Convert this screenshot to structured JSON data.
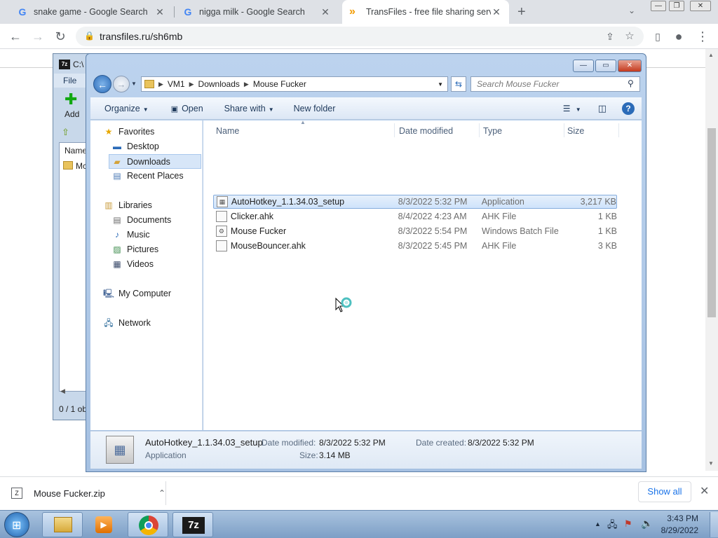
{
  "browser": {
    "tabs": [
      {
        "title": "snake game - Google Search"
      },
      {
        "title": "nigga milk - Google Search"
      },
      {
        "title": "TransFiles - free file sharing servi"
      }
    ],
    "url": "transfiles.ru/sh6mb"
  },
  "sevenzip": {
    "title_fragment": "C:\\",
    "menu_file": "File",
    "add_label": "Add",
    "column_name": "Name",
    "item_fragment": "Mc",
    "status_fragment": "0 / 1 ob"
  },
  "explorer": {
    "breadcrumb": [
      "VM1",
      "Downloads",
      "Mouse Fucker"
    ],
    "search_placeholder": "Search Mouse Fucker",
    "commands": {
      "organize": "Organize",
      "open": "Open",
      "share_with": "Share with",
      "new_folder": "New folder"
    },
    "nav": {
      "favorites": "Favorites",
      "desktop": "Desktop",
      "downloads": "Downloads",
      "recent_places": "Recent Places",
      "libraries": "Libraries",
      "documents": "Documents",
      "music": "Music",
      "pictures": "Pictures",
      "videos": "Videos",
      "my_computer": "My Computer",
      "network": "Network"
    },
    "columns": {
      "name": "Name",
      "date": "Date modified",
      "type": "Type",
      "size": "Size"
    },
    "files": [
      {
        "name": "AutoHotkey_1.1.34.03_setup",
        "date": "8/3/2022 5:32 PM",
        "type": "Application",
        "size": "3,217 KB"
      },
      {
        "name": "Clicker.ahk",
        "date": "8/4/2022 4:23 AM",
        "type": "AHK File",
        "size": "1 KB"
      },
      {
        "name": "Mouse Fucker",
        "date": "8/3/2022 5:54 PM",
        "type": "Windows Batch File",
        "size": "1 KB"
      },
      {
        "name": "MouseBouncer.ahk",
        "date": "8/3/2022 5:45 PM",
        "type": "AHK File",
        "size": "3 KB"
      }
    ],
    "details": {
      "name": "AutoHotkey_1.1.34.03_setup",
      "kind": "Application",
      "date_modified_label": "Date modified:",
      "date_modified": "8/3/2022 5:32 PM",
      "date_created_label": "Date created:",
      "date_created": "8/3/2022 5:32 PM",
      "size_label": "Size:",
      "size": "3.14 MB"
    }
  },
  "download_shelf": {
    "file": "Mouse Fucker.zip",
    "show_all": "Show all"
  },
  "taskbar": {
    "time": "3:43 PM",
    "date": "8/29/2022",
    "sevenzip_label": "7z"
  },
  "colors": {
    "chrome_tabstrip": "#dee1e6",
    "explorer_frame": "#bcd3ee",
    "selection": "#cfe3fb",
    "link_blue": "#1a73e8"
  }
}
